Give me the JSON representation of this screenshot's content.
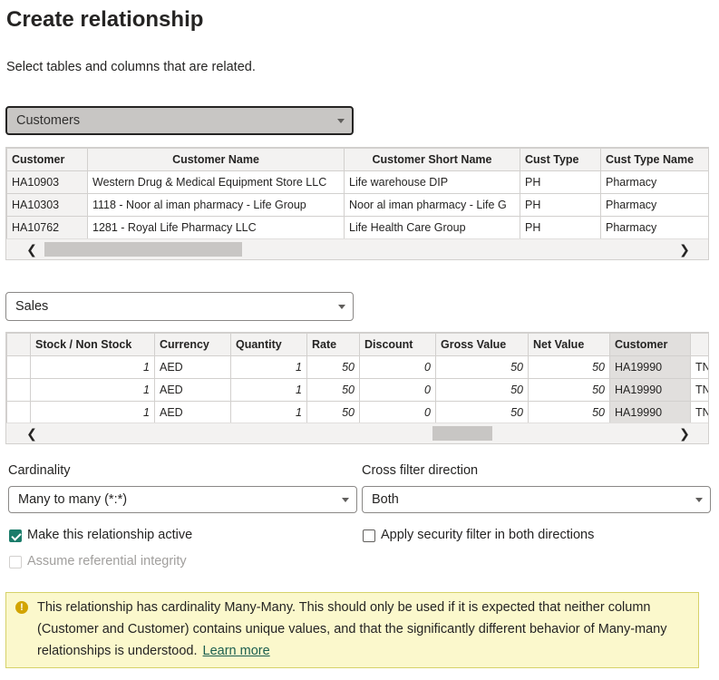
{
  "header": {
    "title": "Create relationship",
    "subtitle": "Select tables and columns that are related."
  },
  "table1": {
    "selected": "Customers",
    "columns": [
      "Customer",
      "Customer Name",
      "Customer Short Name",
      "Cust Type",
      "Cust Type Name"
    ],
    "rows": [
      [
        "HA10903",
        "Western Drug & Medical Equipment Store LLC",
        "Life warehouse DIP",
        "PH",
        "Pharmacy"
      ],
      [
        "HA10303",
        "1118 - Noor al iman pharmacy - Life Group",
        "Noor al iman pharmacy - Life G",
        "PH",
        "Pharmacy"
      ],
      [
        "HA10762",
        "1281 - Royal Life Pharmacy LLC",
        "Life Health Care Group",
        "PH",
        "Pharmacy"
      ]
    ],
    "scroll_left_icon": "chevron-left",
    "scroll_right_icon": "chevron-right"
  },
  "table2": {
    "selected": "Sales",
    "columns": [
      "",
      "Stock / Non Stock",
      "Currency",
      "Quantity",
      "Rate",
      "Discount",
      "Gross Value",
      "Net Value",
      "Customer",
      ""
    ],
    "rows": [
      [
        "",
        "1",
        "AED",
        "1",
        "50",
        "0",
        "50",
        "50",
        "HA19990",
        "TN"
      ],
      [
        "",
        "1",
        "AED",
        "1",
        "50",
        "0",
        "50",
        "50",
        "HA19990",
        "TN"
      ],
      [
        "",
        "1",
        "AED",
        "1",
        "50",
        "0",
        "50",
        "50",
        "HA19990",
        "TN"
      ]
    ]
  },
  "cardinality": {
    "label": "Cardinality",
    "value": "Many to many (*:*)"
  },
  "cross_filter": {
    "label": "Cross filter direction",
    "value": "Both"
  },
  "options": {
    "active_label": "Make this relationship active",
    "active_checked": true,
    "security_label": "Apply security filter in both directions",
    "security_checked": false,
    "integrity_label": "Assume referential integrity",
    "integrity_checked": false
  },
  "warning": {
    "icon": "!",
    "text": "This relationship has cardinality Many-Many. This should only be used if it is expected that neither column (Customer and Customer) contains unique values, and that the significantly different behavior of Many-many relationships is understood.",
    "link": "Learn more"
  },
  "colors": {
    "accent": "#1b7c6a",
    "warning_bg": "#fbf8cc",
    "header_bg": "#f3f2f1"
  }
}
